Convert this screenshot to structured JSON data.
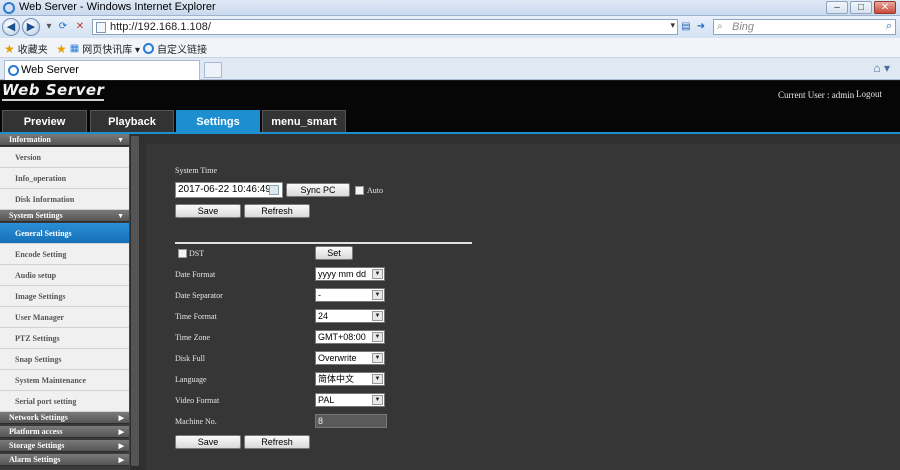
{
  "browser": {
    "window_title": "Web Server - Windows Internet Explorer",
    "url": "http://192.168.1.108/",
    "search_placeholder": "Bing",
    "favorites": {
      "label": "收藏夹",
      "items": [
        "网页快讯库 ▾",
        "自定义链接"
      ]
    },
    "tab_title": "Web Server"
  },
  "app": {
    "logo": "Web Server",
    "current_user": "Current User : admin",
    "logout": "Logout",
    "tabs": [
      "Preview",
      "Playback",
      "Settings",
      "menu_smart"
    ],
    "active_tab": "Settings"
  },
  "sidebar": {
    "groups": [
      {
        "label": "Information",
        "items": [
          "Version",
          "Info_operation",
          "Disk Information"
        ]
      },
      {
        "label": "System Settings",
        "items": [
          "General Settings",
          "Encode Setting",
          "Audio setup",
          "Image Settings",
          "User Manager",
          "PTZ Settings",
          "Snap Settings",
          "System Maintenance",
          "Serial port setting"
        ]
      },
      {
        "label": "Network Settings",
        "items": []
      },
      {
        "label": "Platform access",
        "items": []
      },
      {
        "label": "Storage Settings",
        "items": []
      },
      {
        "label": "Alarm Settings",
        "items": []
      }
    ],
    "active_item": "General Settings"
  },
  "form": {
    "system_time_label": "System Time",
    "system_time_value": "2017-06-22 10:46:49",
    "sync_pc": "Sync PC",
    "auto_label": "Auto",
    "save": "Save",
    "refresh": "Refresh",
    "dst_label": "DST",
    "set": "Set",
    "fields": [
      {
        "label": "Date Format",
        "value": "yyyy mm dd"
      },
      {
        "label": "Date Separator",
        "value": "-"
      },
      {
        "label": "Time Format",
        "value": "24"
      },
      {
        "label": "Time Zone",
        "value": "GMT+08:00"
      },
      {
        "label": "Disk Full",
        "value": "Overwrite"
      },
      {
        "label": "Language",
        "value": "简体中文"
      },
      {
        "label": "Video Format",
        "value": "PAL"
      }
    ],
    "machine_no_label": "Machine No.",
    "machine_no_value": "8"
  }
}
